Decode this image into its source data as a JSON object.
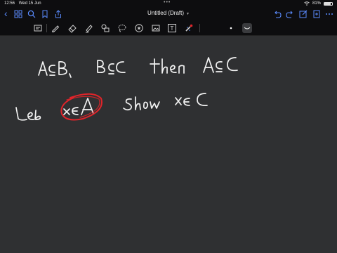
{
  "status": {
    "time": "12:56",
    "date": "Wed 15 Jun",
    "battery": "81%",
    "battery_level": 0.81
  },
  "nav": {
    "title": "Untitled (Draft)"
  },
  "toolbar": {
    "text_tool_label": "T"
  },
  "canvas": {
    "line1": "A⊆B, B⊆C then A⊆C",
    "line2": "Let x∈A Show x∈C",
    "circled": "x∈A"
  },
  "colors": {
    "accent": "#5a8cff",
    "ink": "#f2f2f2",
    "highlight": "#e0242a",
    "canvas": "#2f3032"
  }
}
